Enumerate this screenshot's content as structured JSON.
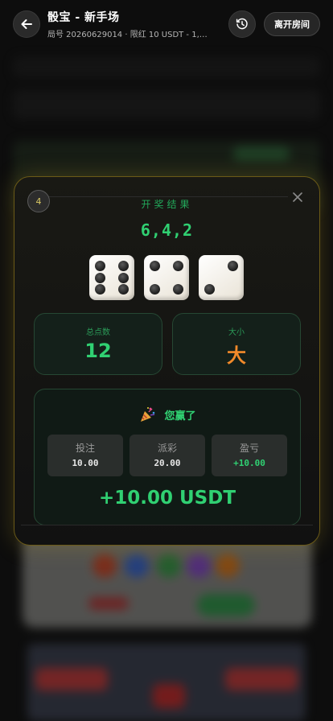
{
  "header": {
    "title": "骰宝 - 新手场",
    "subtitle": "局号 20260629014 · 限红 10 USDT - 1,00...",
    "leave_label": "离开房间"
  },
  "result": {
    "round": "4",
    "label": "开奖结果",
    "numbers": "6,4,2",
    "dice": [
      6,
      4,
      2
    ],
    "total_label": "总点数",
    "total_value": "12",
    "size_label": "大小",
    "size_value": "大"
  },
  "win": {
    "title": "您赢了",
    "items": [
      {
        "label": "投注",
        "value": "10.00"
      },
      {
        "label": "派彩",
        "value": "20.00"
      },
      {
        "label": "盈亏",
        "value": "+10.00"
      }
    ],
    "total": "+10.00 USDT"
  },
  "icons": {
    "back": "arrow-left-icon",
    "history": "history-clock-icon",
    "close": "close-icon",
    "party": "party-popper-icon"
  },
  "colors": {
    "win_green": "#30d072",
    "size_orange": "#f28a2a",
    "gold_border": "#6b5a17"
  }
}
